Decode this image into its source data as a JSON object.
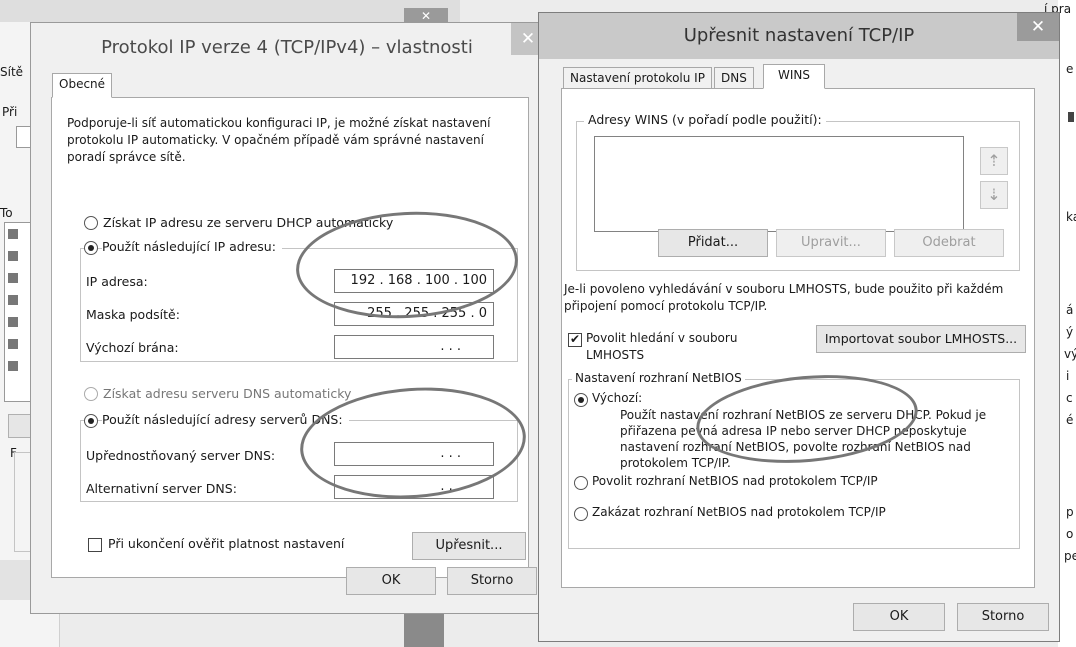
{
  "background": {
    "left_fragments": [
      "Sítě",
      "Při",
      "To",
      "F"
    ],
    "right_fragments": [
      "í pra",
      "e",
      "ka",
      "á",
      "ý",
      "vý",
      "i",
      "c",
      "é",
      "p",
      "o",
      "pe"
    ]
  },
  "ipv4_dialog": {
    "title": "Protokol IP verze 4 (TCP/IPv4) – vlastnosti",
    "close_glyph": "✕",
    "tab_general": "Obecné",
    "intro": [
      "Podporuje-li síť automatickou konfiguraci IP, je možné získat nastavení",
      "protokolu IP automaticky. V opačném případě vám správné nastavení",
      "poradí správce sítě."
    ],
    "radio_auto_ip": "Získat IP adresu ze serveru DHCP automaticky",
    "radio_manual_ip": "Použít následující IP adresu:",
    "ip_label": "IP adresa:",
    "ip_value": "192 . 168 . 100 . 100",
    "mask_label": "Maska podsítě:",
    "mask_value": "255 . 255 . 255 .  0",
    "gateway_label": "Výchozí brána:",
    "gateway_value": ".       .       .",
    "radio_auto_dns": "Získat adresu serveru DNS automaticky",
    "radio_manual_dns": "Použít následující adresy serverů DNS:",
    "dns_pref_label": "Upřednostňovaný server DNS:",
    "dns_pref_value": ".       .       .",
    "dns_alt_label": "Alternativní server DNS:",
    "dns_alt_value": ".       .       .",
    "validate_label": "Při ukončení ověřit platnost nastavení",
    "advanced_btn": "Upřesnit...",
    "ok_btn": "OK",
    "cancel_btn": "Storno"
  },
  "advanced_dialog": {
    "title": "Upřesnit nastavení TCP/IP",
    "close_glyph": "✕",
    "tabs": [
      "Nastavení protokolu IP",
      "DNS",
      "WINS"
    ],
    "wins_group": "Adresy WINS (v pořadí podle použití):",
    "arrow_up": "⇡",
    "arrow_down": "⇣",
    "add_btn": "Přidat...",
    "edit_btn": "Upravit...",
    "remove_btn": "Odebrat",
    "lmhosts_info": [
      "Je-li povoleno vyhledávání v souboru LMHOSTS, bude použito při každém",
      "připojení pomocí protokolu TCP/IP."
    ],
    "lmhosts_check": [
      "Povolit hledání v souboru",
      "LMHOSTS"
    ],
    "import_btn": "Importovat soubor LMHOSTS...",
    "netbios_group": "Nastavení rozhraní NetBIOS",
    "radio_default": "Výchozí:",
    "default_desc": [
      "Použít nastavení rozhraní NetBIOS ze serveru DHCP. Pokud je",
      "přiřazena pevná adresa IP nebo server DHCP neposkytuje",
      "nastavení rozhraní NetBIOS, povolte rozhraní NetBIOS nad",
      "protokolem TCP/IP."
    ],
    "radio_enable": "Povolit rozhraní NetBIOS nad protokolem TCP/IP",
    "radio_disable": "Zakázat rozhraní NetBIOS nad protokolem TCP/IP",
    "ok_btn": "OK",
    "cancel_btn": "Storno"
  }
}
